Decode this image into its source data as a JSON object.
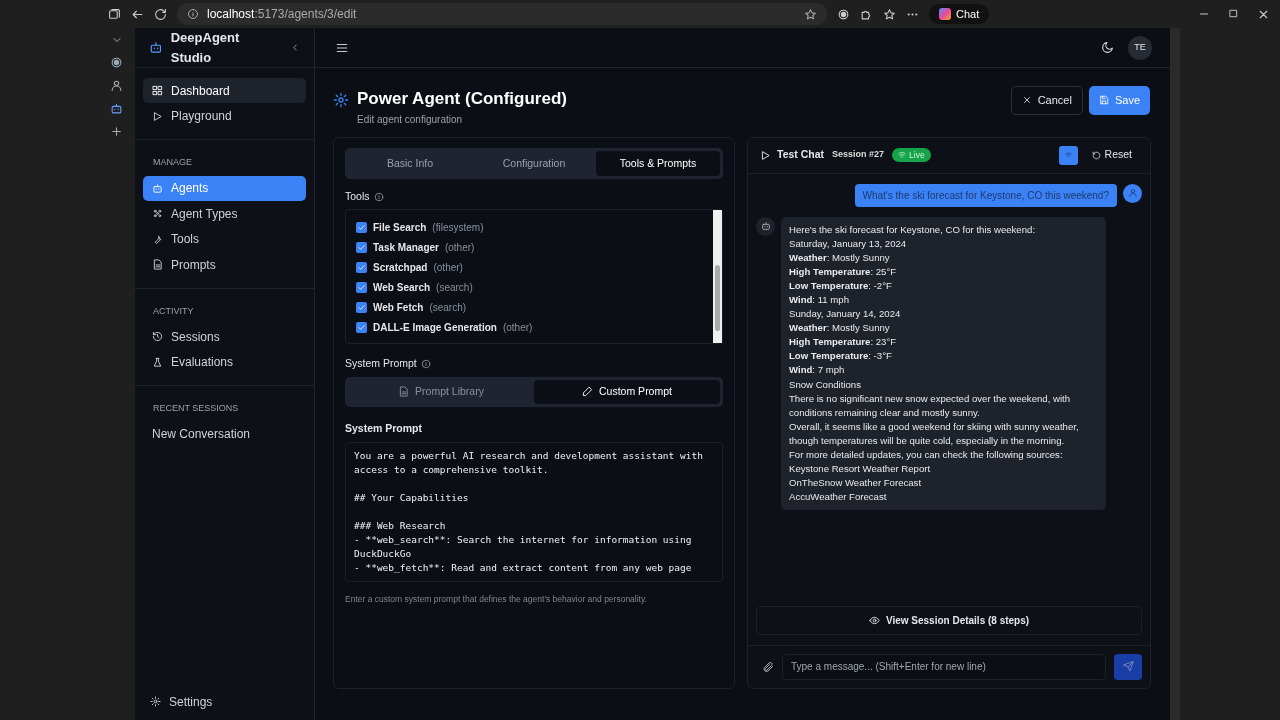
{
  "browser": {
    "url_host": "localhost",
    "url_path": ":5173/agents/3/edit",
    "chat_label": "Chat"
  },
  "sidebar": {
    "brand": "DeepAgent Studio",
    "sections": [
      {
        "items": [
          {
            "label": "Dashboard",
            "selected": false,
            "highlighted": true
          },
          {
            "label": "Playground",
            "selected": false,
            "highlighted": false
          }
        ]
      },
      {
        "heading": "MANAGE",
        "items": [
          {
            "label": "Agents",
            "selected": true,
            "highlighted": false
          },
          {
            "label": "Agent Types",
            "selected": false,
            "highlighted": false
          },
          {
            "label": "Tools",
            "selected": false,
            "highlighted": false
          },
          {
            "label": "Prompts",
            "selected": false,
            "highlighted": false
          }
        ]
      },
      {
        "heading": "ACTIVITY",
        "items": [
          {
            "label": "Sessions",
            "selected": false,
            "highlighted": false
          },
          {
            "label": "Evaluations",
            "selected": false,
            "highlighted": false
          }
        ]
      }
    ],
    "recent_heading": "RECENT SESSIONS",
    "recent": [
      "New Conversation"
    ],
    "settings": "Settings"
  },
  "header": {
    "user_initials": "TE"
  },
  "page": {
    "title": "Power Agent (Configured)",
    "subtitle": "Edit agent configuration",
    "cancel": "Cancel",
    "save": "Save"
  },
  "tabs": [
    {
      "label": "Basic Info",
      "selected": false
    },
    {
      "label": "Configuration",
      "selected": false
    },
    {
      "label": "Tools & Prompts",
      "selected": true
    }
  ],
  "tools": {
    "label": "Tools",
    "items": [
      {
        "name": "File Search",
        "category": "(filesystem)",
        "checked": true
      },
      {
        "name": "Task Manager",
        "category": "(other)",
        "checked": true
      },
      {
        "name": "Scratchpad",
        "category": "(other)",
        "checked": true
      },
      {
        "name": "Web Search",
        "category": "(search)",
        "checked": true
      },
      {
        "name": "Web Fetch",
        "category": "(search)",
        "checked": true
      },
      {
        "name": "DALL-E Image Generation",
        "category": "(other)",
        "checked": true
      }
    ]
  },
  "system_prompt": {
    "label": "System Prompt",
    "modes": [
      {
        "label": "Prompt Library",
        "selected": false
      },
      {
        "label": "Custom Prompt",
        "selected": true
      }
    ],
    "field_label": "System Prompt",
    "value": "You are a powerful AI research and development assistant with access to a comprehensive toolkit.\n\n## Your Capabilities\n\n### Web Research\n- **web_search**: Search the internet for information using DuckDuckGo\n- **web_fetch**: Read and extract content from any web page",
    "help": "Enter a custom system prompt that defines the agent's behavior and personality."
  },
  "chat": {
    "title": "Test Chat",
    "session": "Session #27",
    "status": "Live",
    "reset": "Reset",
    "user_message": "What's the ski forecast for Keystone, CO this weekend?",
    "reply_lines": [
      "Here's the ski forecast for Keystone, CO for this weekend:",
      "Saturday, January 13, 2024",
      "**Weather**: Mostly Sunny",
      "**High Temperature**: 25°F",
      "**Low Temperature**: -2°F",
      "**Wind**: 11 mph",
      "Sunday, January 14, 2024",
      "**Weather**: Mostly Sunny",
      "**High Temperature**: 23°F",
      "**Low Temperature**: -3°F",
      "**Wind**: 7 mph",
      "Snow Conditions",
      "There is no significant new snow expected over the weekend, with conditions remaining clear and mostly sunny.",
      "Overall, it seems like a good weekend for skiing with sunny weather, though temperatures will be quite cold, especially in the morning.",
      "For more detailed updates, you can check the following sources:",
      "Keystone Resort Weather Report",
      "OnTheSnow Weather Forecast",
      "AccuWeather Forecast"
    ],
    "details_button": "View Session Details (8 steps)",
    "input_placeholder": "Type a message... (Shift+Enter for new line)"
  }
}
